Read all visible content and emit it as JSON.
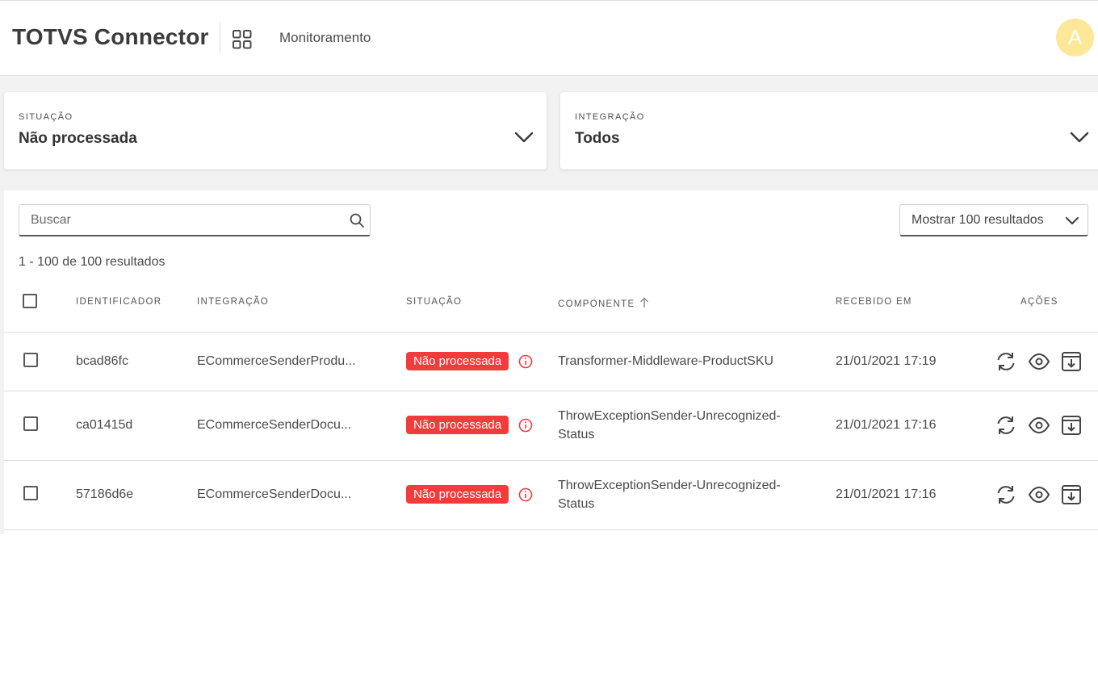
{
  "header": {
    "app_title": "TOTVS Connector",
    "page_name": "Monitoramento",
    "avatar_initial": "A"
  },
  "filters": {
    "situacao": {
      "label": "SITUAÇÃO",
      "value": "Não processada"
    },
    "integracao": {
      "label": "INTEGRAÇÃO",
      "value": "Todos"
    }
  },
  "search": {
    "placeholder": "Buscar",
    "value": ""
  },
  "page_size": {
    "label": "Mostrar 100 resultados"
  },
  "result_count": "1 - 100 de 100 resultados",
  "table": {
    "columns": {
      "identificador": "IDENTIFICADOR",
      "integracao": "INTEGRAÇÃO",
      "situacao": "SITUAÇÃO",
      "componente": "COMPONENTE",
      "recebido_em": "RECEBIDO EM",
      "acoes": "AÇÕES"
    },
    "sorted_column": "componente",
    "sort_direction": "ascending",
    "rows": [
      {
        "id": "bcad86fc",
        "integracao": "ECommerceSenderProdu...",
        "situacao": "Não processada",
        "componente": "Transformer-Middleware-ProductSKU",
        "recebido_em": "21/01/2021 17:19"
      },
      {
        "id": "ca01415d",
        "integracao": "ECommerceSenderDocu...",
        "situacao": "Não processada",
        "componente": "ThrowExceptionSender-Unrecognized-Status",
        "recebido_em": "21/01/2021 17:16"
      },
      {
        "id": "57186d6e",
        "integracao": "ECommerceSenderDocu...",
        "situacao": "Não processada",
        "componente": "ThrowExceptionSender-Unrecognized-Status",
        "recebido_em": "21/01/2021 17:16"
      }
    ]
  },
  "colors": {
    "status_error": "#f23c3c",
    "avatar_bg": "#fde89a",
    "background_grey": "#f2f2f2"
  },
  "icons": [
    "apps-grid-icon",
    "chevron-down-icon",
    "search-icon",
    "info-icon",
    "sort-arrow-up-icon",
    "reprocess-icon",
    "view-icon",
    "archive-download-icon"
  ]
}
